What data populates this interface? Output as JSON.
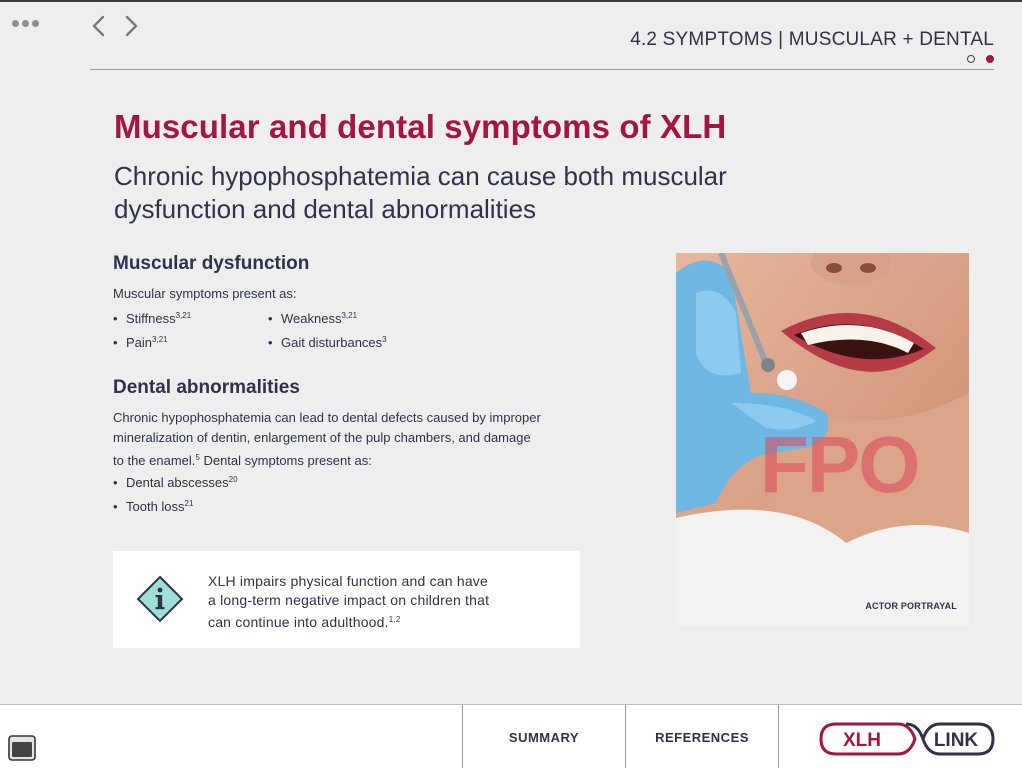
{
  "header": {
    "section_title": "4.2 SYMPTOMS | MUSCULAR + DENTAL",
    "pager": {
      "total": 2,
      "current": 2
    }
  },
  "content": {
    "title": "Muscular and dental symptoms of XLH",
    "subtitle": "Chronic hypophosphatemia can cause both muscular dysfunction and dental abnormalities",
    "muscular": {
      "heading": "Muscular dysfunction",
      "intro": "Muscular symptoms present as:",
      "bullets": [
        {
          "text": "Stiffness",
          "ref": "3,21"
        },
        {
          "text": "Weakness",
          "ref": "3,21"
        },
        {
          "text": "Pain",
          "ref": "3,21"
        },
        {
          "text": "Gait disturbances",
          "ref": "3"
        }
      ]
    },
    "dental": {
      "heading": "Dental abnormalities",
      "paragraph_line1": "Chronic hypophosphatemia can lead to dental defects caused by improper",
      "paragraph_line2": "mineralization of dentin, enlargement of the pulp chambers, and damage",
      "paragraph_line3_a": "to the enamel.",
      "paragraph_ref": "5",
      "paragraph_line3_b": " Dental symptoms present as:",
      "bullets": [
        {
          "text": "Dental abscesses",
          "ref": "20"
        },
        {
          "text": "Tooth loss",
          "ref": "21"
        }
      ]
    },
    "callout": {
      "line1": "XLH impairs physical function and can have",
      "line2": "a long-term negative impact on children that",
      "line3": "can continue into adulthood.",
      "ref": "1,2",
      "icon": "info-diamond-icon"
    },
    "image": {
      "watermark": "FPO",
      "caption": "ACTOR PORTRAYAL"
    }
  },
  "footer": {
    "summary_label": "SUMMARY",
    "references_label": "REFERENCES",
    "logo_left": "XLH",
    "logo_right": "LINK"
  },
  "colors": {
    "brand": "#a3163f",
    "text": "#2e3349",
    "callout_icon": "#9fe0d6"
  }
}
